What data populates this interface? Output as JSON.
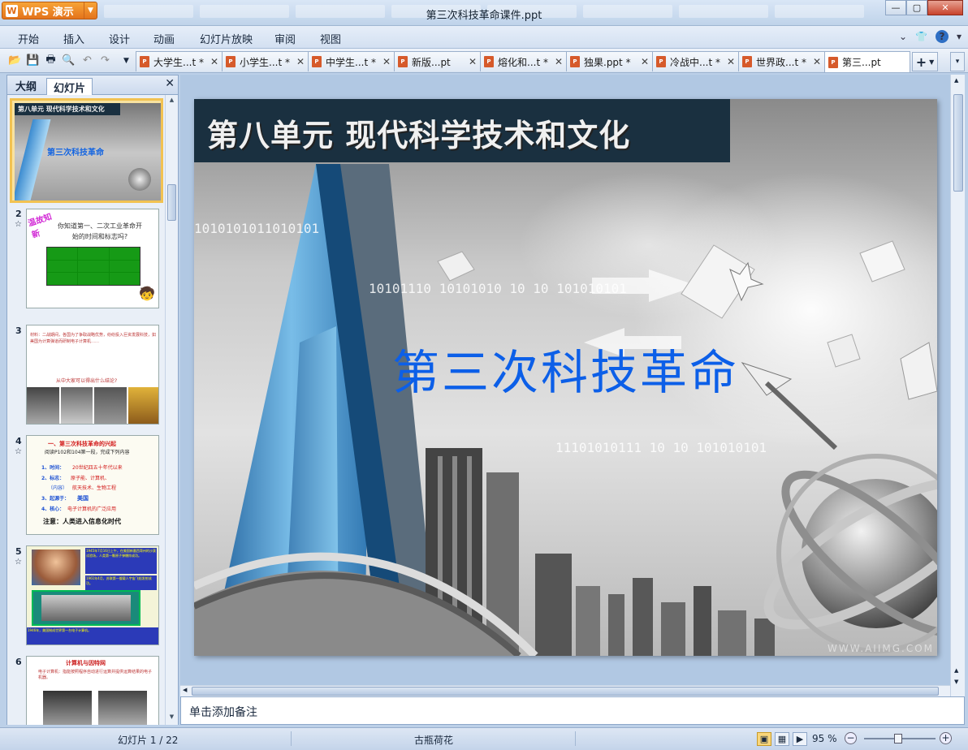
{
  "app": {
    "name": "WPS 演示",
    "logo": "W",
    "window_title": "第三次科技革命课件.ppt"
  },
  "menu": [
    "开始",
    "插入",
    "设计",
    "动画",
    "幻灯片放映",
    "审阅",
    "视图"
  ],
  "tabs": [
    {
      "label": "大学生...t *"
    },
    {
      "label": "小学生...t *"
    },
    {
      "label": "中学生...t *"
    },
    {
      "label": "新版...pt"
    },
    {
      "label": "熔化和...t *"
    },
    {
      "label": "独果.ppt *"
    },
    {
      "label": "冷战中...t *"
    },
    {
      "label": "世界政...t *"
    },
    {
      "label": "第三...pt"
    }
  ],
  "pane": {
    "outline_tab": "大纲",
    "slides_tab": "幻灯片"
  },
  "thumbnails": {
    "numbers": [
      "1",
      "2",
      "3",
      "4",
      "5",
      "6"
    ],
    "t1": {
      "header": "第八单元 现代科学技术和文化",
      "title": "第三次科技革命"
    },
    "t2": {
      "tag": "温故知新",
      "question": "你知道第一、二次工业革命开始的时间和标志吗?"
    },
    "t3": {
      "text": "材料：二战期间，各国为了争取战略优势，纷纷投入巨资发展科技，如美国为计算弹道而研制电子计算机……",
      "question": "从中大家可以得出什么结论?"
    },
    "t4": {
      "heading": "一、第三次科技革命的兴起",
      "sub": "阅读P102和104第一段，完成下列内容",
      "l1": "1、时间：",
      "l1v": "20世纪四五十年代以来",
      "l2": "2、标志：",
      "l2v": "原子能、计算机、",
      "l3": "（内容）",
      "l3v": "航天技术、生物工程",
      "l4": "3、起源于：",
      "l4v": "美国",
      "l5": "4、核心：",
      "l5v": "电子计算机的广泛应用",
      "note": "注意：人类进入信息化时代"
    },
    "t5": {
      "t1": "1945年7月16日上午，在美国新墨西哥州的沙漠试验场，人类第一颗原子弹爆炸成功。",
      "t2": "1961年4月，苏联第一艘载人宇宙飞船发射成功。",
      "t3": "1946年，美国制成世界第一台电子计算机。"
    },
    "t6": {
      "title": "计算机与因特网",
      "text": "电子计算机：指能按照程序自动进行运算并提供运算结果的电子机器。"
    }
  },
  "slide": {
    "header": "第八单元  现代科学技术和文化",
    "title": "第三次科技革命",
    "binary1": "1010101011010101",
    "binary2": "10101110     10101010   10 10 101010101",
    "binary3": "11101010111     10 10 101010101",
    "watermark": "WWW.AIIMG.COM"
  },
  "notes_placeholder": "单击添加备注",
  "status": {
    "slide_indicator": "幻灯片 1 / 22",
    "theme": "古瓶荷花",
    "zoom": "95 %",
    "zoom_percent": 95
  }
}
